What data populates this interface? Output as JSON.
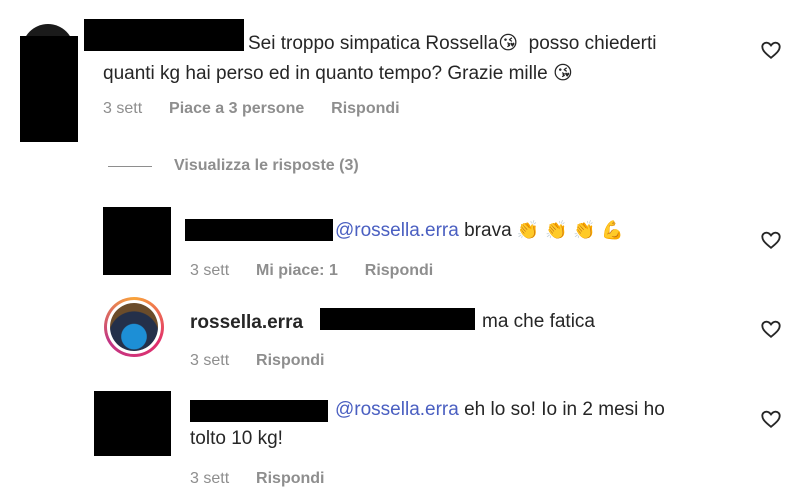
{
  "comment1": {
    "text_line1": "Sei troppo simpatica Rossella",
    "emoji1": "😘",
    "text_line1b": "posso chiederti",
    "text_line2": "quanti kg hai perso ed in quanto tempo? Grazie mille",
    "emoji2": "😘",
    "time": "3 sett",
    "likes": "Piace a 3 persone",
    "reply": "Rispondi"
  },
  "view_replies": "Visualizza le risposte (3)",
  "reply1": {
    "mention": "@rossella.erra",
    "text": "brava",
    "emojis": "👏 👏 👏 💪",
    "time": "3 sett",
    "likes": "Mi piace: 1",
    "reply": "Rispondi"
  },
  "reply2": {
    "username": "rossella.erra",
    "text": "ma che fatica",
    "time": "3 sett",
    "reply": "Rispondi"
  },
  "reply3": {
    "mention": "@rossella.erra",
    "text_line1": "eh lo so! Io in 2 mesi ho",
    "text_line2": "tolto 10 kg!",
    "time": "3 sett",
    "reply": "Rispondi"
  },
  "icons": {
    "like": "heart-outline-icon"
  },
  "colors": {
    "mention": "#4a5fc1",
    "meta": "#8e8e8e"
  }
}
